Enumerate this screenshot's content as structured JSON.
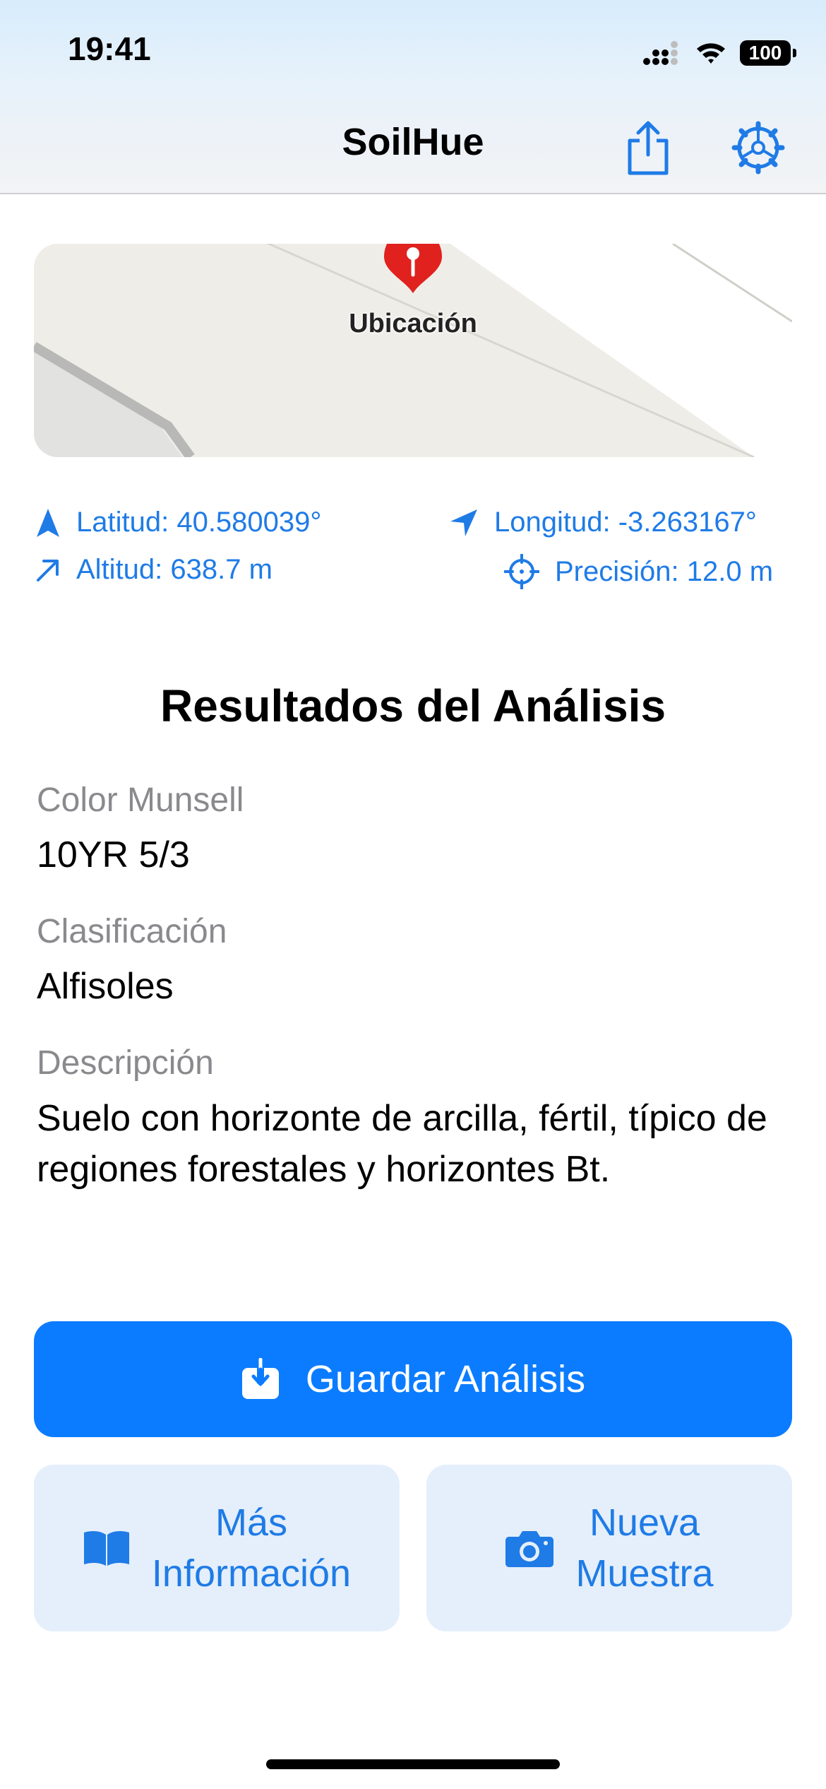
{
  "status_bar": {
    "time": "19:41",
    "battery": "100"
  },
  "nav": {
    "title": "SoilHue",
    "share_icon": "share-icon",
    "settings_icon": "gear-icon"
  },
  "map": {
    "pin_label": "Ubicación"
  },
  "location": {
    "latitude": "Latitud: 40.580039°",
    "longitude": "Longitud: -3.263167°",
    "altitude": "Altitud: 638.7 m",
    "precision": "Precisión: 12.0 m"
  },
  "results": {
    "title": "Resultados del Análisis",
    "munsell_label": "Color Munsell",
    "munsell_value": "10YR 5/3",
    "classification_label": "Clasificación",
    "classification_value": "Alfisoles",
    "description_label": "Descripción",
    "description_value": "Suelo con horizonte de arcilla, fértil, típico de regiones forestales y horizontes Bt."
  },
  "actions": {
    "save": "Guardar Análisis",
    "more_info": "Más\nInformación",
    "new_sample": "Nueva\nMuestra"
  },
  "colors": {
    "accent": "#0b7cff",
    "link": "#1f7be6",
    "secondary_bg": "#e4effb",
    "label_gray": "#8a8a8e",
    "pin_red": "#e0211e"
  }
}
